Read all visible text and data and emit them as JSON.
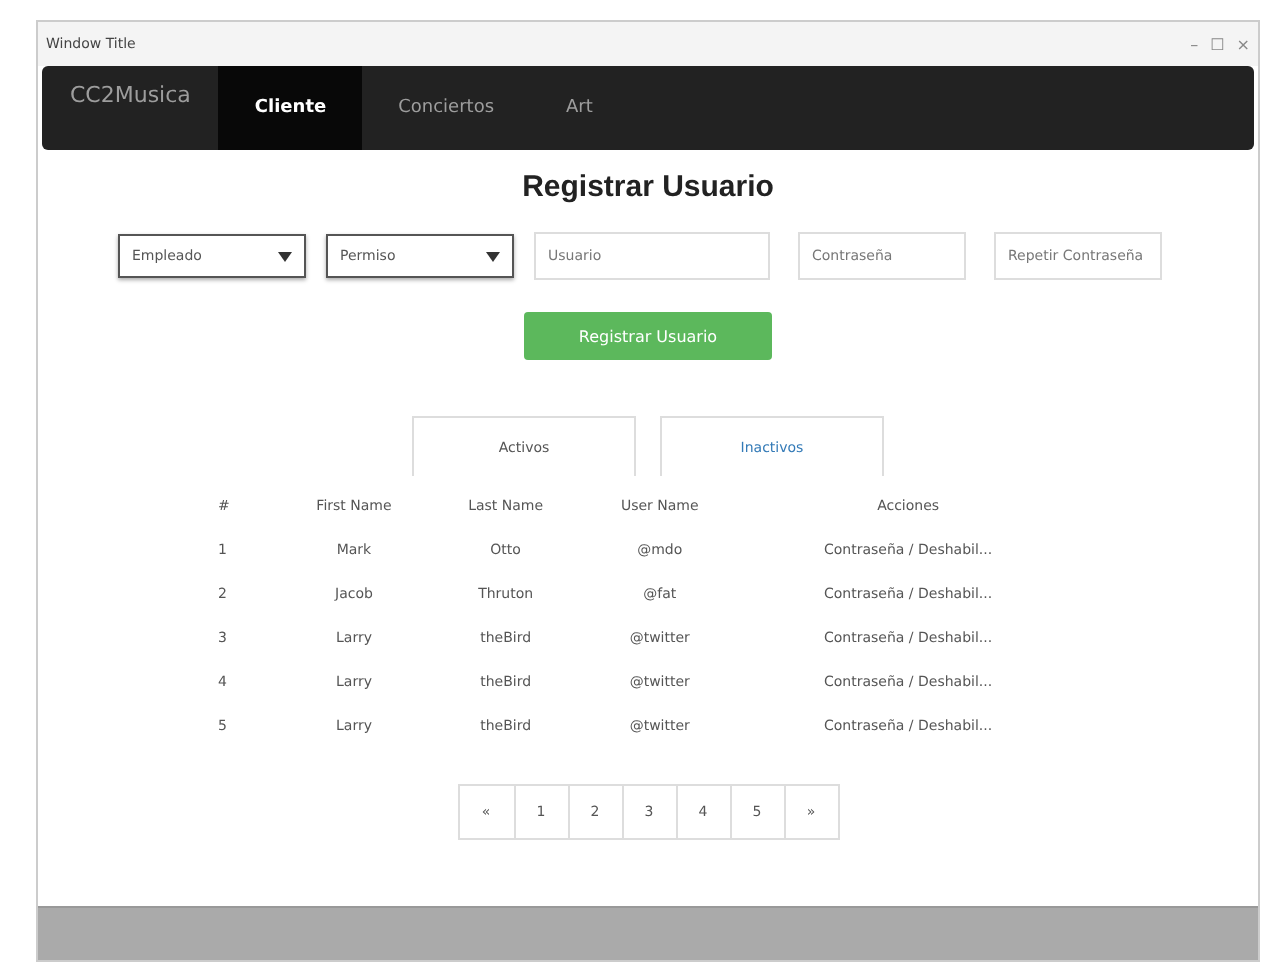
{
  "window": {
    "title": "Window Title",
    "controls": [
      "–",
      "☐",
      "×"
    ]
  },
  "navbar": {
    "brand": "CC2Musica",
    "items": [
      {
        "label": "Cliente",
        "selected": true
      },
      {
        "label": "Conciertos",
        "selected": false
      },
      {
        "label": "Art",
        "selected": false
      }
    ]
  },
  "form": {
    "title": "Registrar Usuario",
    "selects": [
      {
        "value": "Empleado"
      },
      {
        "value": "Permiso"
      }
    ],
    "inputs": [
      {
        "placeholder": "Usuario"
      },
      {
        "placeholder": "Contraseña"
      },
      {
        "placeholder": "Repetir Contraseña"
      }
    ],
    "submit": "Registrar Usuario"
  },
  "tabs": [
    {
      "label": "Activos",
      "selected": false
    },
    {
      "label": "Inactivos",
      "selected": true
    }
  ],
  "table": {
    "columns": [
      "#",
      "First Name",
      "Last Name",
      "User Name",
      "Acciones"
    ],
    "rows": [
      [
        "1",
        "Mark",
        "Otto",
        "@mdo",
        "Contraseña / Deshabil..."
      ],
      [
        "2",
        "Jacob",
        "Thruton",
        "@fat",
        "Contraseña / Deshabil..."
      ],
      [
        "3",
        "Larry",
        "theBird",
        "@twitter",
        "Contraseña / Deshabil..."
      ],
      [
        "4",
        "Larry",
        "theBird",
        "@twitter",
        "Contraseña / Deshabil..."
      ],
      [
        "5",
        "Larry",
        "theBird",
        "@twitter",
        "Contraseña / Deshabil..."
      ]
    ]
  },
  "pagination": [
    "«",
    "1",
    "2",
    "3",
    "4",
    "5",
    "»"
  ]
}
